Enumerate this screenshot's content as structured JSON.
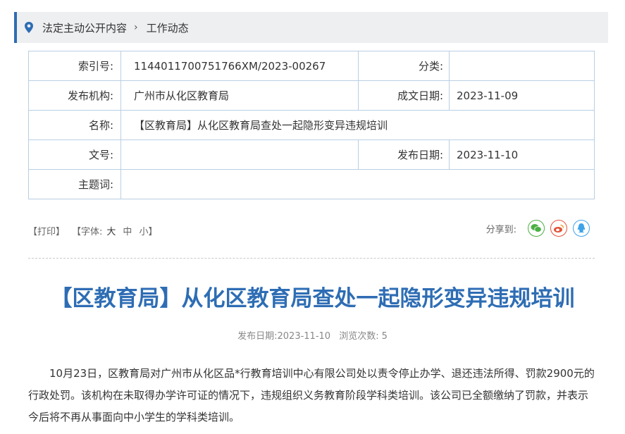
{
  "breadcrumb": {
    "items": [
      "法定主动公开内容",
      "工作动态"
    ]
  },
  "meta": {
    "index_label": "索引号:",
    "index_value": "1144011700751766XM/2023-00267",
    "category_label": "分类:",
    "category_value": "",
    "publisher_label": "发布机构:",
    "publisher_value": "广州市从化区教育局",
    "created_label": "成文日期:",
    "created_value": "2023-11-09",
    "name_label": "名称:",
    "name_value": "【区教育局】从化区教育局查处一起隐形变异违规培训",
    "docno_label": "文号:",
    "docno_value": "",
    "pubdate_label": "发布日期:",
    "pubdate_value": "2023-11-10",
    "subject_label": "主题词:",
    "subject_value": ""
  },
  "tools": {
    "print": "【打印】",
    "font_prefix": "【字体:",
    "large": "大",
    "medium": "中",
    "small": "小",
    "font_suffix": "】",
    "share_label": "分享到:"
  },
  "article": {
    "title": "【区教育局】从化区教育局查处一起隐形变异违规培训",
    "info_prefix": "发布日期:",
    "date": "2023-11-10",
    "views_prefix": "浏览次数:",
    "views": "5",
    "body": "10月23日，区教育局对广州市从化区品*行教育培训中心有限公司处以责令停止办学、退还违法所得、罚款2900元的行政处罚。该机构在未取得办学许可证的情况下，违规组织义务教育阶段学科类培训。该公司已全额缴纳了罚款，并表示今后将不再从事面向中小学生的学科类培训。"
  },
  "colors": {
    "accent": "#2e6db4",
    "wechat": "#4bb044",
    "weibo": "#e2533a",
    "qq": "#3ea4e8"
  }
}
